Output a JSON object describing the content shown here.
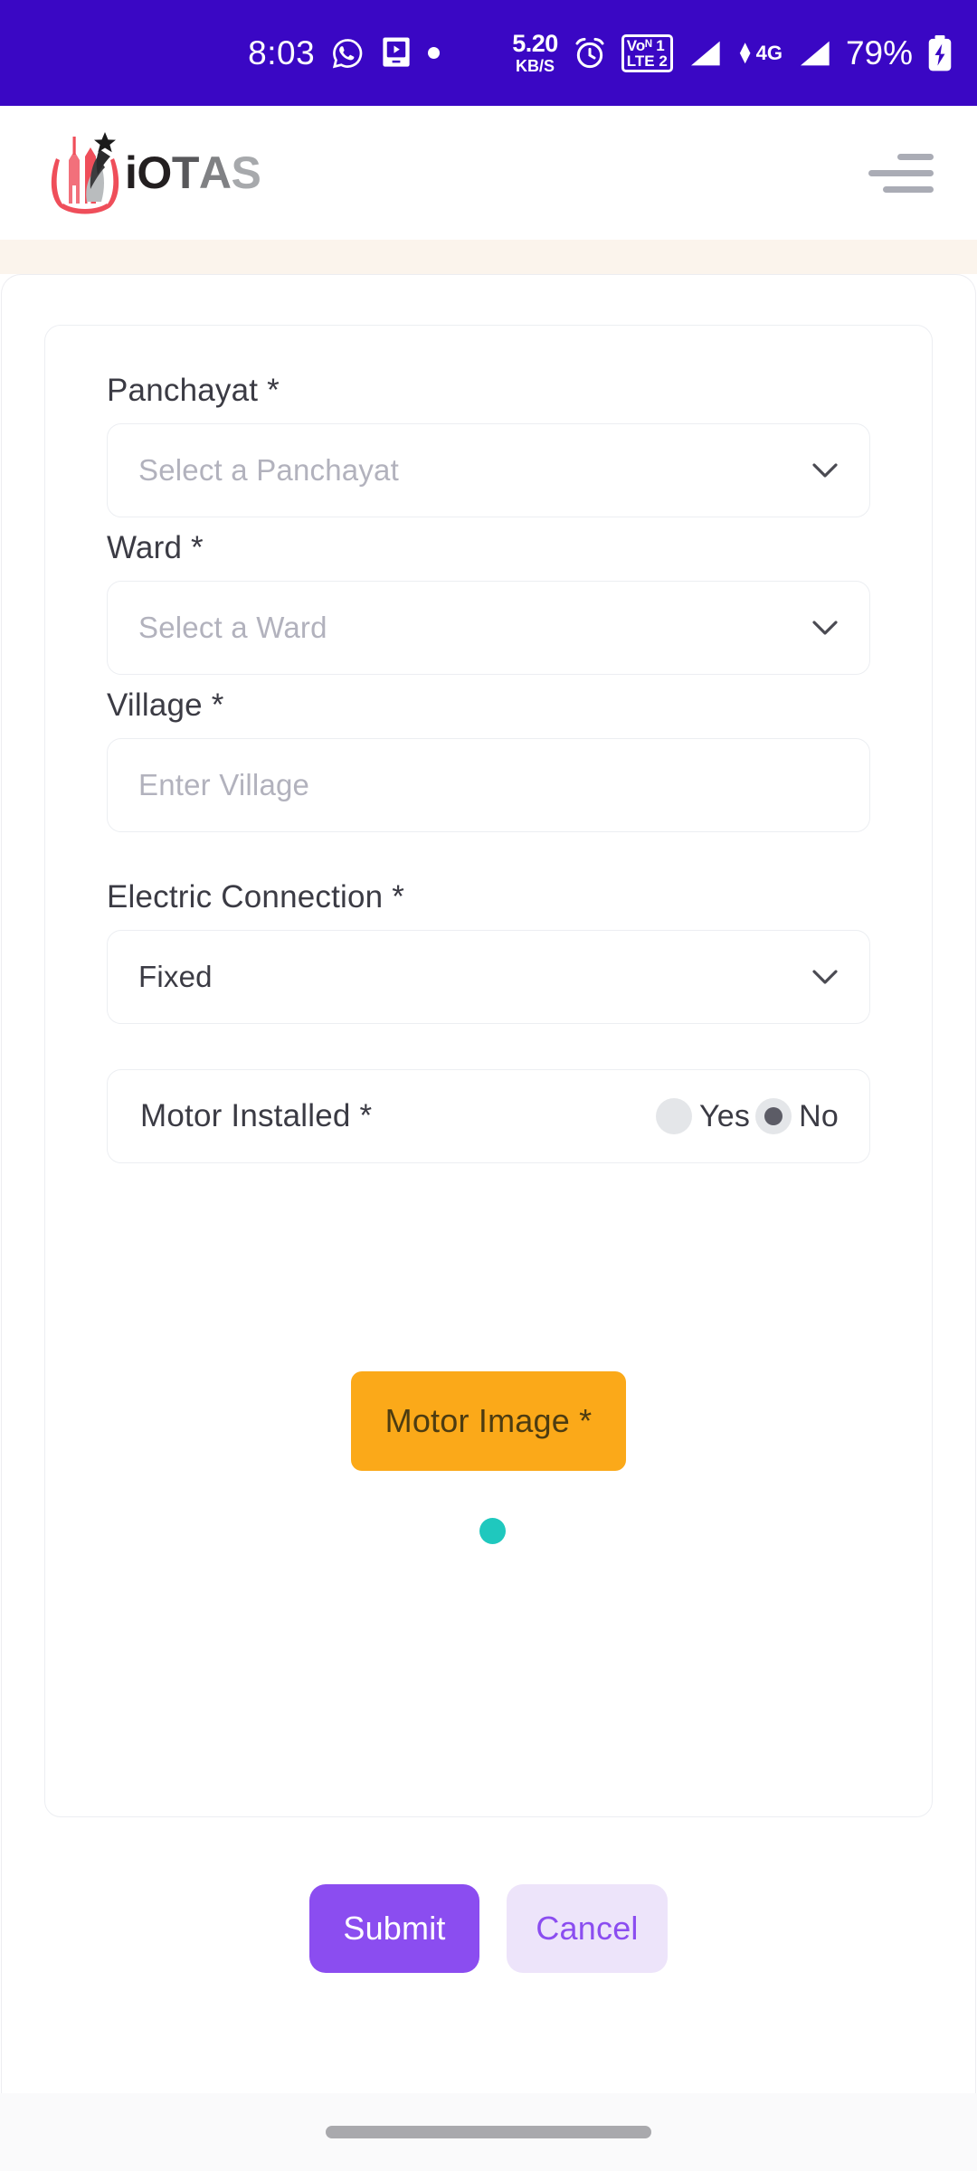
{
  "status_bar": {
    "time": "8:03",
    "icons_left": [
      "whatsapp-icon",
      "screen-record-icon",
      "dot-indicator"
    ],
    "net_speed_value": "5.20",
    "net_speed_unit": "KB/S",
    "alarm_icon": "alarm-clock-icon",
    "volte_line1": "Voᴺ 1",
    "volte_line2": "LTE 2",
    "network_type": "4G",
    "battery_percent": "79%",
    "battery_icon": "battery-charging-icon",
    "background_color": "#3A07C4"
  },
  "header": {
    "brand_letters": {
      "i": "i",
      "o": "O",
      "t": "T",
      "a": "A",
      "s": "S"
    },
    "brand_full": "iOTAS",
    "menu_icon": "hamburger-menu-icon"
  },
  "form": {
    "panchayat": {
      "label": "Panchayat *",
      "placeholder": "Select a Panchayat",
      "value": ""
    },
    "ward": {
      "label": "Ward *",
      "placeholder": "Select a Ward",
      "value": ""
    },
    "village": {
      "label": "Village *",
      "placeholder": "Enter Village",
      "value": ""
    },
    "electric_connection": {
      "label": "Electric Connection *",
      "value": "Fixed",
      "options": [
        "Fixed"
      ]
    },
    "motor_installed": {
      "label": "Motor Installed *",
      "option_yes": "Yes",
      "option_no": "No",
      "selected": "No"
    },
    "motor_image": {
      "button_label": "Motor Image *",
      "button_color": "#FBA919",
      "preview_badge_color": "#1FC8BE",
      "preview_empty": true
    }
  },
  "actions": {
    "submit_label": "Submit",
    "submit_color": "#8B4DF0",
    "cancel_label": "Cancel",
    "cancel_color": "#EDE4FA"
  },
  "nav_bar": {
    "home_indicator": "home-indicator-pill"
  }
}
